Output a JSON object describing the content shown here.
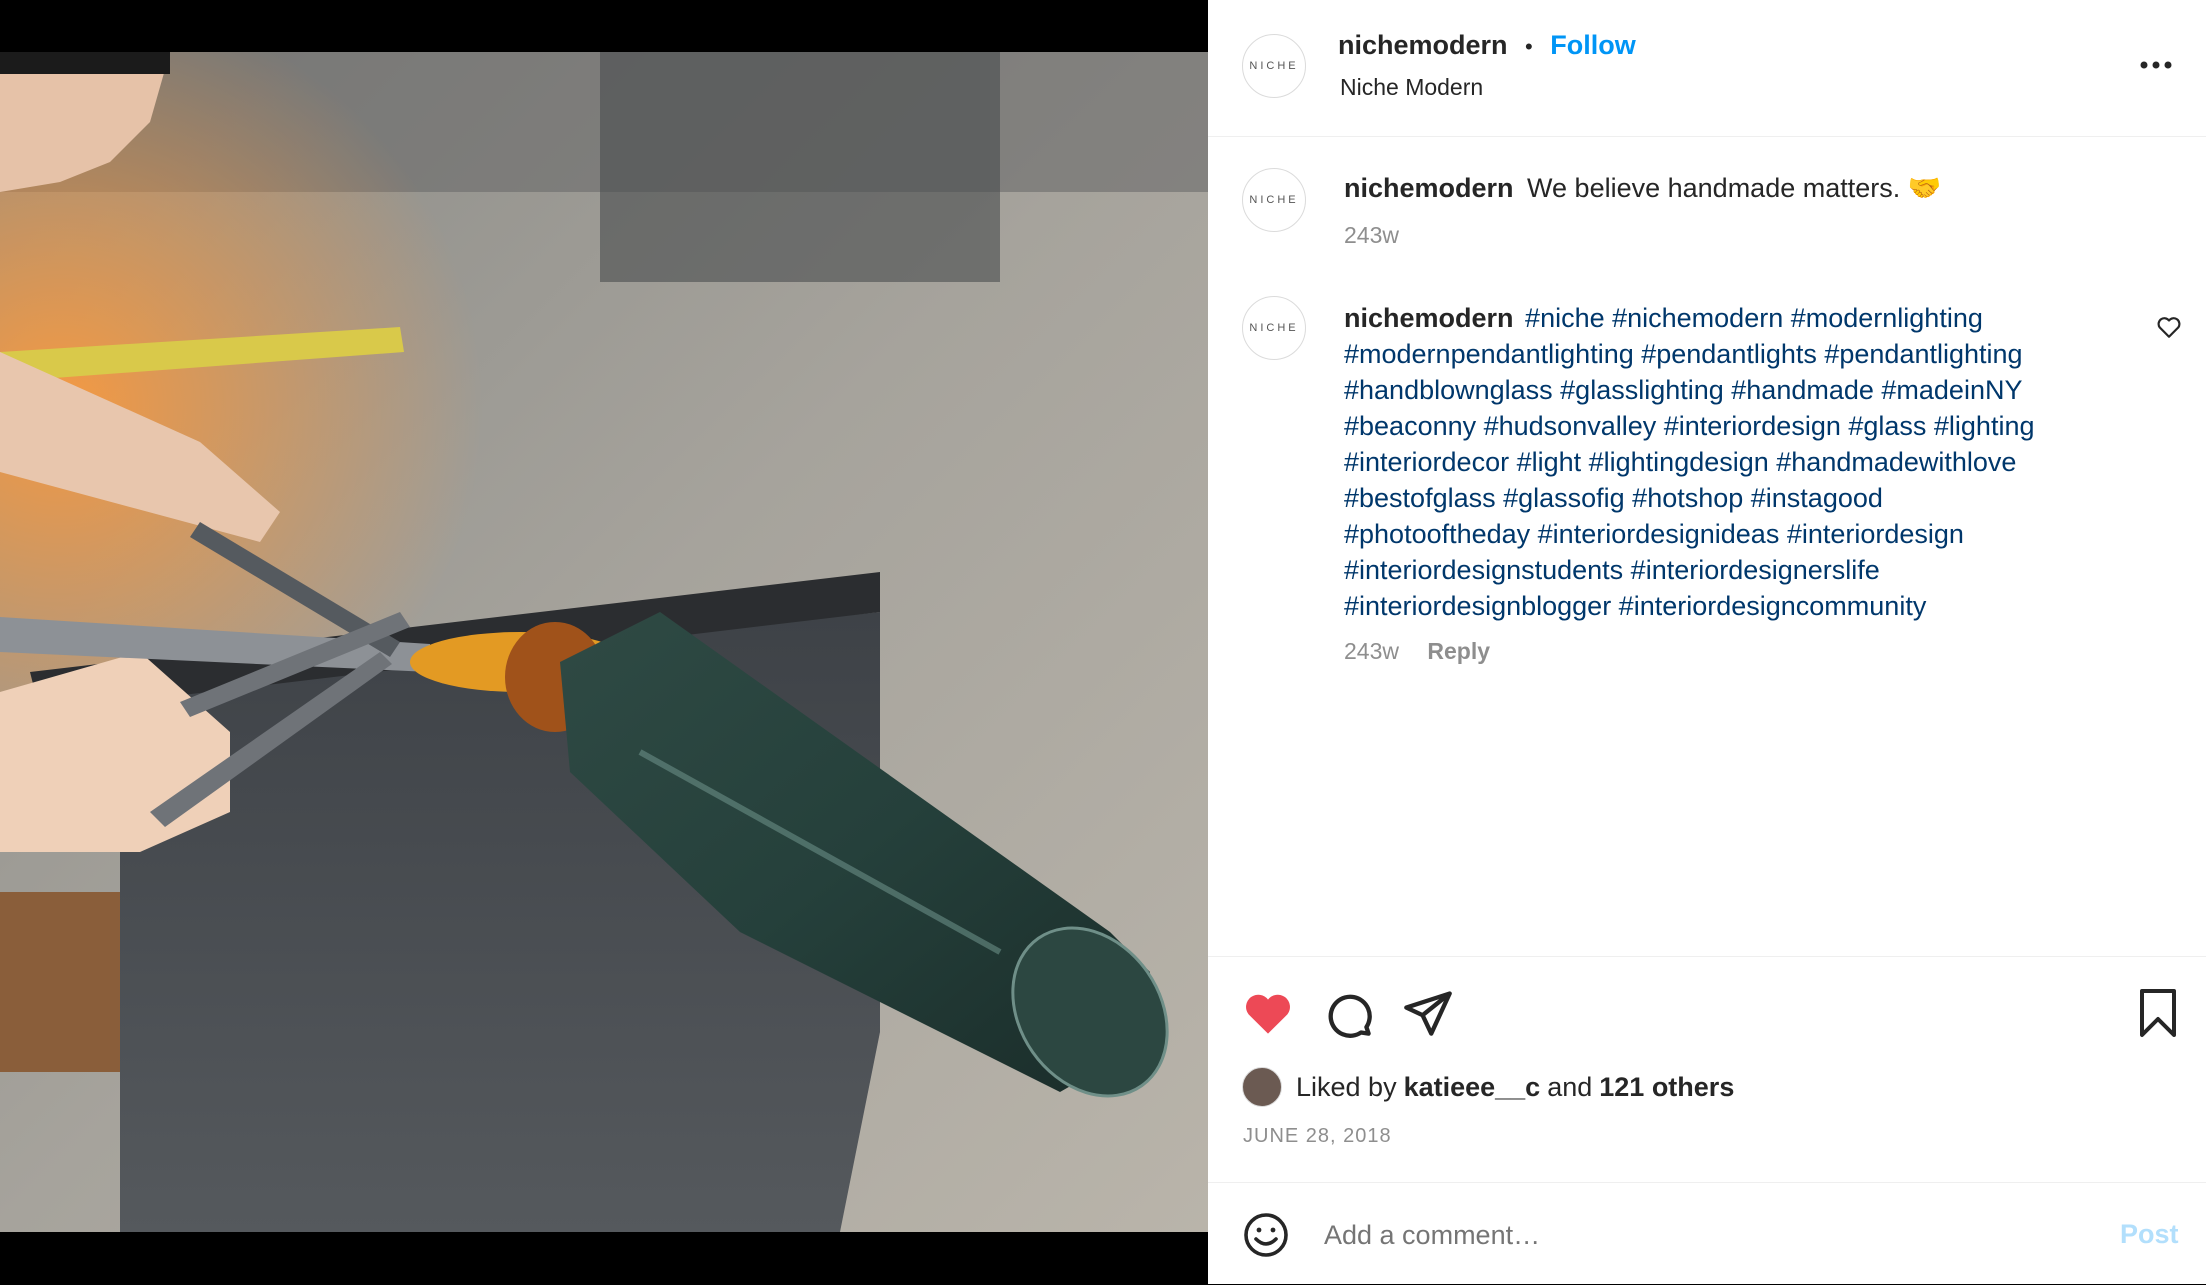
{
  "post": {
    "image_alt": "Glassblower shaping a dark green glass pendant with tongs",
    "colors": {
      "accent": "#0095f6",
      "like": "#ed4956",
      "hashtag": "#00376b",
      "muted": "#8e8e8e"
    }
  },
  "header": {
    "avatar_text": "NICHE",
    "username": "nichemodern",
    "separator": "•",
    "follow_label": "Follow",
    "subtitle": "Niche Modern",
    "more_icon": "more-options-icon"
  },
  "comments": [
    {
      "avatar_text": "NICHE",
      "username": "nichemodern",
      "text": "We believe handmade matters. 🤝",
      "time": "243w"
    },
    {
      "avatar_text": "NICHE",
      "username": "nichemodern",
      "lines": [
        "#niche #nichemodern #modernlighting",
        "#modernpendantlighting #pendantlights #pendantlighting",
        "#handblownglass #glasslighting #handmade #madeinNY",
        "#beaconny #hudsonvalley #interiordesign #glass #lighting",
        "#interiordecor #light #lightingdesign #handmadewithlove",
        "#bestofglass #glassofig #hotshop #instagood",
        "#photooftheday #interiordesignideas #interiordesign",
        "#interiordesignstudents #interiordesignerslife",
        "#interiordesignblogger #interiordesigncommunity"
      ],
      "time": "243w",
      "reply_label": "Reply"
    }
  ],
  "actions": {
    "liked_prefix": "Liked by",
    "liked_user": "katieee__c",
    "liked_and": "and",
    "liked_others": "121 others",
    "date": "JUNE 28, 2018"
  },
  "comment_box": {
    "placeholder": "Add a comment…",
    "post_label": "Post"
  }
}
